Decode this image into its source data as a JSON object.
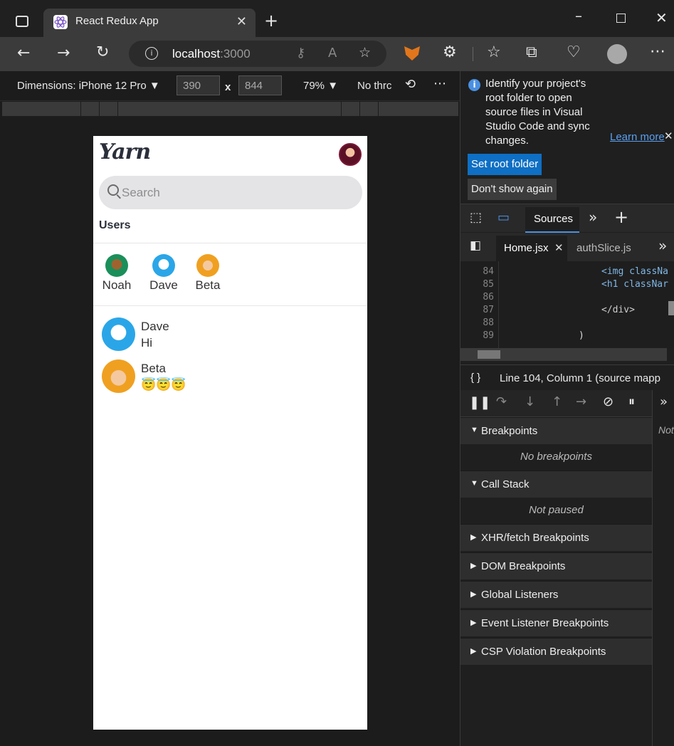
{
  "browser": {
    "tab_title": "React Redux App",
    "url_host": "localhost",
    "url_port": ":3000"
  },
  "device_toolbar": {
    "dimensions_label": "Dimensions: iPhone 12 Pro",
    "width": "390",
    "height": "844",
    "times": "x",
    "zoom": "79%",
    "throttle": "No thrc"
  },
  "app": {
    "logo": "Yarn",
    "search_placeholder": "Search",
    "users_heading": "Users",
    "users": [
      {
        "name": "Noah",
        "color": "#1a8f5a"
      },
      {
        "name": "Dave",
        "color": "#2aa6e8"
      },
      {
        "name": "Beta",
        "color": "#f0a020"
      }
    ],
    "conversations": [
      {
        "name": "Dave",
        "message": "Hi",
        "color": "#2aa6e8"
      },
      {
        "name": "Beta",
        "message": "😇😇😇",
        "color": "#f0a020"
      }
    ]
  },
  "devtools": {
    "info_message": "Identify your project's root folder to open source files in Visual Studio Code and sync changes.",
    "learn_more": "Learn more",
    "set_root_folder": "Set root folder",
    "dont_show_again": "Don't show again",
    "sources_tab": "Sources",
    "file_tabs": [
      "Home.jsx",
      "authSlice.js"
    ],
    "code_lines": [
      {
        "num": "84",
        "text": "<img classNa"
      },
      {
        "num": "85",
        "text": "<h1 classNar"
      },
      {
        "num": "86",
        "text": ""
      },
      {
        "num": "87",
        "text": "</div>"
      },
      {
        "num": "88",
        "text": ""
      },
      {
        "num": "89",
        "text": ")"
      }
    ],
    "status_brace": "{ }",
    "status_text": "Line 104, Column 1  (source mapp",
    "side_text": "Not",
    "panes": {
      "breakpoints": "Breakpoints",
      "no_breakpoints": "No breakpoints",
      "call_stack": "Call Stack",
      "not_paused": "Not paused",
      "xhr": "XHR/fetch Breakpoints",
      "dom": "DOM Breakpoints",
      "global": "Global Listeners",
      "event": "Event Listener Breakpoints",
      "csp": "CSP Violation Breakpoints"
    }
  }
}
